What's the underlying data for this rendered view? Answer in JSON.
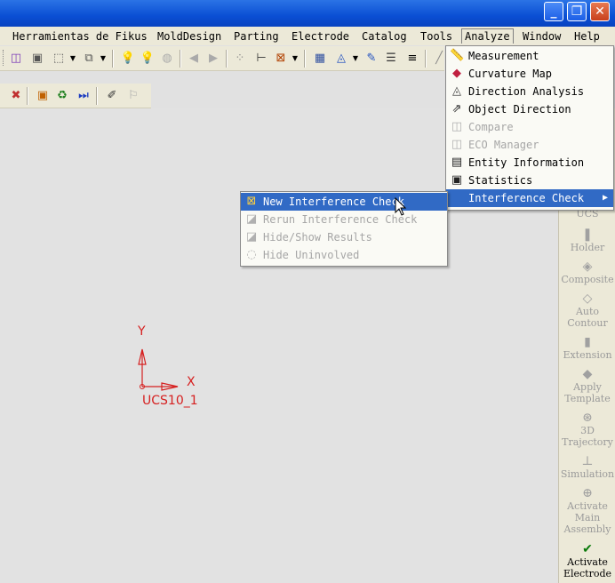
{
  "window": {
    "controls": {
      "minimize": "_",
      "maximize": "❐",
      "close": "✕"
    }
  },
  "menubar": {
    "items": [
      {
        "label": "Herramientas de Fikus"
      },
      {
        "label": "MoldDesign"
      },
      {
        "label": "Parting"
      },
      {
        "label": "Electrode"
      },
      {
        "label": "Catalog"
      },
      {
        "label": "Tools"
      },
      {
        "label": "Analyze",
        "active": true
      },
      {
        "label": "Window"
      },
      {
        "label": "Help"
      }
    ]
  },
  "analyze_menu": {
    "items": [
      {
        "label": "Measurement",
        "icon": "ruler-icon",
        "enabled": true
      },
      {
        "label": "Curvature Map",
        "icon": "curvature-icon",
        "enabled": true
      },
      {
        "label": "Direction Analysis",
        "icon": "direction-icon",
        "enabled": true
      },
      {
        "label": "Object Direction",
        "icon": "object-direction-icon",
        "enabled": true
      },
      {
        "label": "Compare",
        "icon": "compare-icon",
        "enabled": false
      },
      {
        "label": "ECO Manager",
        "icon": "eco-icon",
        "enabled": false
      },
      {
        "label": "Entity Information",
        "icon": "info-icon",
        "enabled": true
      },
      {
        "label": "Statistics",
        "icon": "statistics-icon",
        "enabled": true
      },
      {
        "label": "Interference Check",
        "icon": "",
        "enabled": true,
        "highlighted": true,
        "submenu": true
      }
    ]
  },
  "interference_submenu": {
    "items": [
      {
        "label": "New Interference Check",
        "highlighted": true,
        "enabled": true
      },
      {
        "label": "Rerun Interference Check",
        "enabled": false
      },
      {
        "label": "Hide/Show Results",
        "enabled": false
      },
      {
        "label": "Hide Uninvolved",
        "enabled": false
      }
    ]
  },
  "right_panel": {
    "buttons": [
      {
        "label": "UCS",
        "enabled": false
      },
      {
        "label": "Holder",
        "enabled": false
      },
      {
        "label": "Composite",
        "enabled": false
      },
      {
        "label": "Auto Contour",
        "enabled": false
      },
      {
        "label": "Extension",
        "enabled": false
      },
      {
        "label": "Apply Template",
        "enabled": false
      },
      {
        "label": "3D Trajectory",
        "enabled": false
      },
      {
        "label": "Simulation",
        "enabled": false
      },
      {
        "label": "Activate Main Assembly",
        "enabled": false
      },
      {
        "label": "Activate Electrode",
        "enabled": true
      }
    ]
  },
  "canvas": {
    "ucs_name": "UCS10_1",
    "axis_x": "X",
    "axis_y": "Y"
  },
  "colors": {
    "accent": "#316ac5",
    "ucs": "#d62020"
  }
}
